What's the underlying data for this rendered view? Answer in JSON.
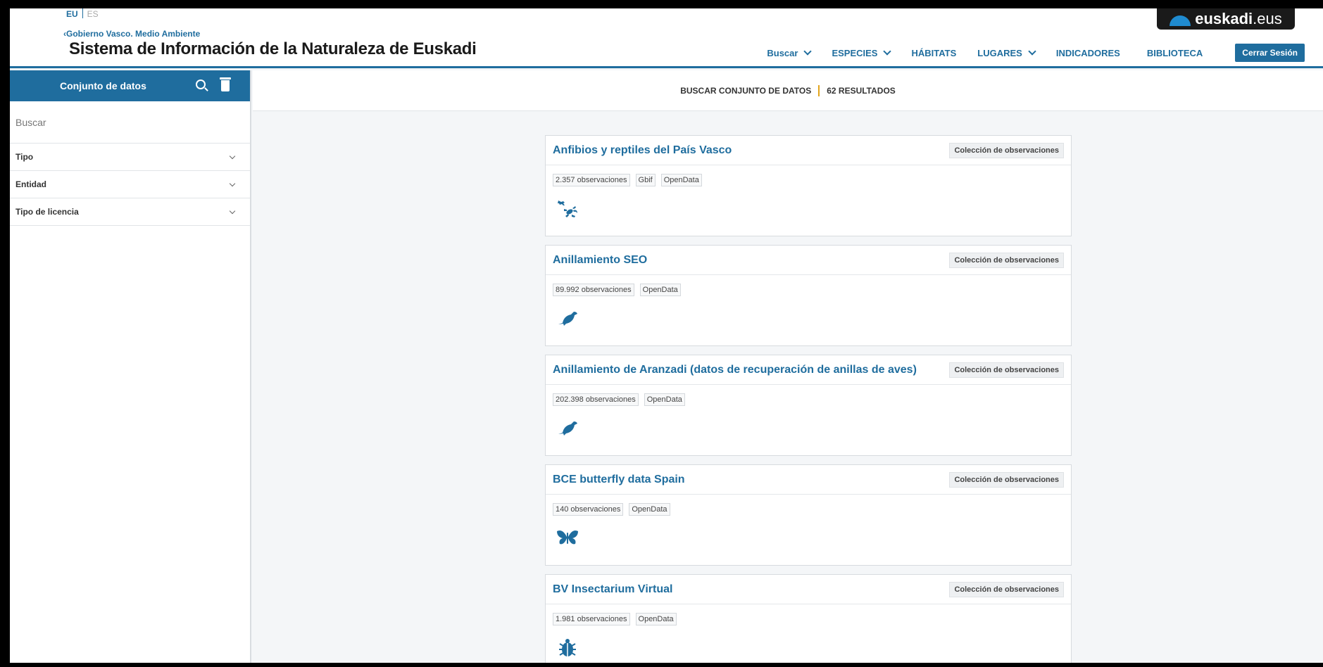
{
  "header": {
    "lang_eu": "EU",
    "lang_es": "ES",
    "back_link": "Gobierno Vasco. Medio Ambiente",
    "site_title": "Sistema de Información de la Naturaleza de Euskadi",
    "logo_bold": "euskadi",
    "logo_light": ".eus",
    "nav": {
      "buscar": "Buscar",
      "especies": "ESPECIES",
      "habitats": "HÁBITATS",
      "lugares": "LUGARES",
      "indicadores": "INDICADORES",
      "biblioteca": "BIBLIOTECA",
      "logout": "Cerrar Sesión"
    }
  },
  "sidebar": {
    "title": "Conjunto de datos",
    "search_placeholder": "Buscar",
    "filters": [
      "Tipo",
      "Entidad",
      "Tipo de licencia"
    ]
  },
  "results": {
    "label": "BUSCAR CONJUNTO DE DATOS",
    "count": "62 RESULTADOS"
  },
  "cards": [
    {
      "title": "Anfibios y reptiles del País Vasco",
      "badge": "Colección de observaciones",
      "tags": [
        "2.357 observaciones",
        "Gbif",
        "OpenData"
      ],
      "icon": "frog-lizard-icon"
    },
    {
      "title": "Anillamiento SEO",
      "badge": "Colección de observaciones",
      "tags": [
        "89.992 observaciones",
        "OpenData"
      ],
      "icon": "bird-icon"
    },
    {
      "title": "Anillamiento de Aranzadi (datos de recuperación de anillas de aves)",
      "badge": "Colección de observaciones",
      "tags": [
        "202.398 observaciones",
        "OpenData"
      ],
      "icon": "bird-icon"
    },
    {
      "title": "BCE butterfly data Spain",
      "badge": "Colección de observaciones",
      "tags": [
        "140 observaciones",
        "OpenData"
      ],
      "icon": "butterfly-icon"
    },
    {
      "title": "BV Insectarium Virtual",
      "badge": "Colección de observaciones",
      "tags": [
        "1.981 observaciones",
        "OpenData"
      ],
      "icon": "beetle-icon"
    }
  ],
  "colors": {
    "primary": "#1f6d9e",
    "accent": "#e3a51c",
    "icon": "#1f6d9e"
  }
}
